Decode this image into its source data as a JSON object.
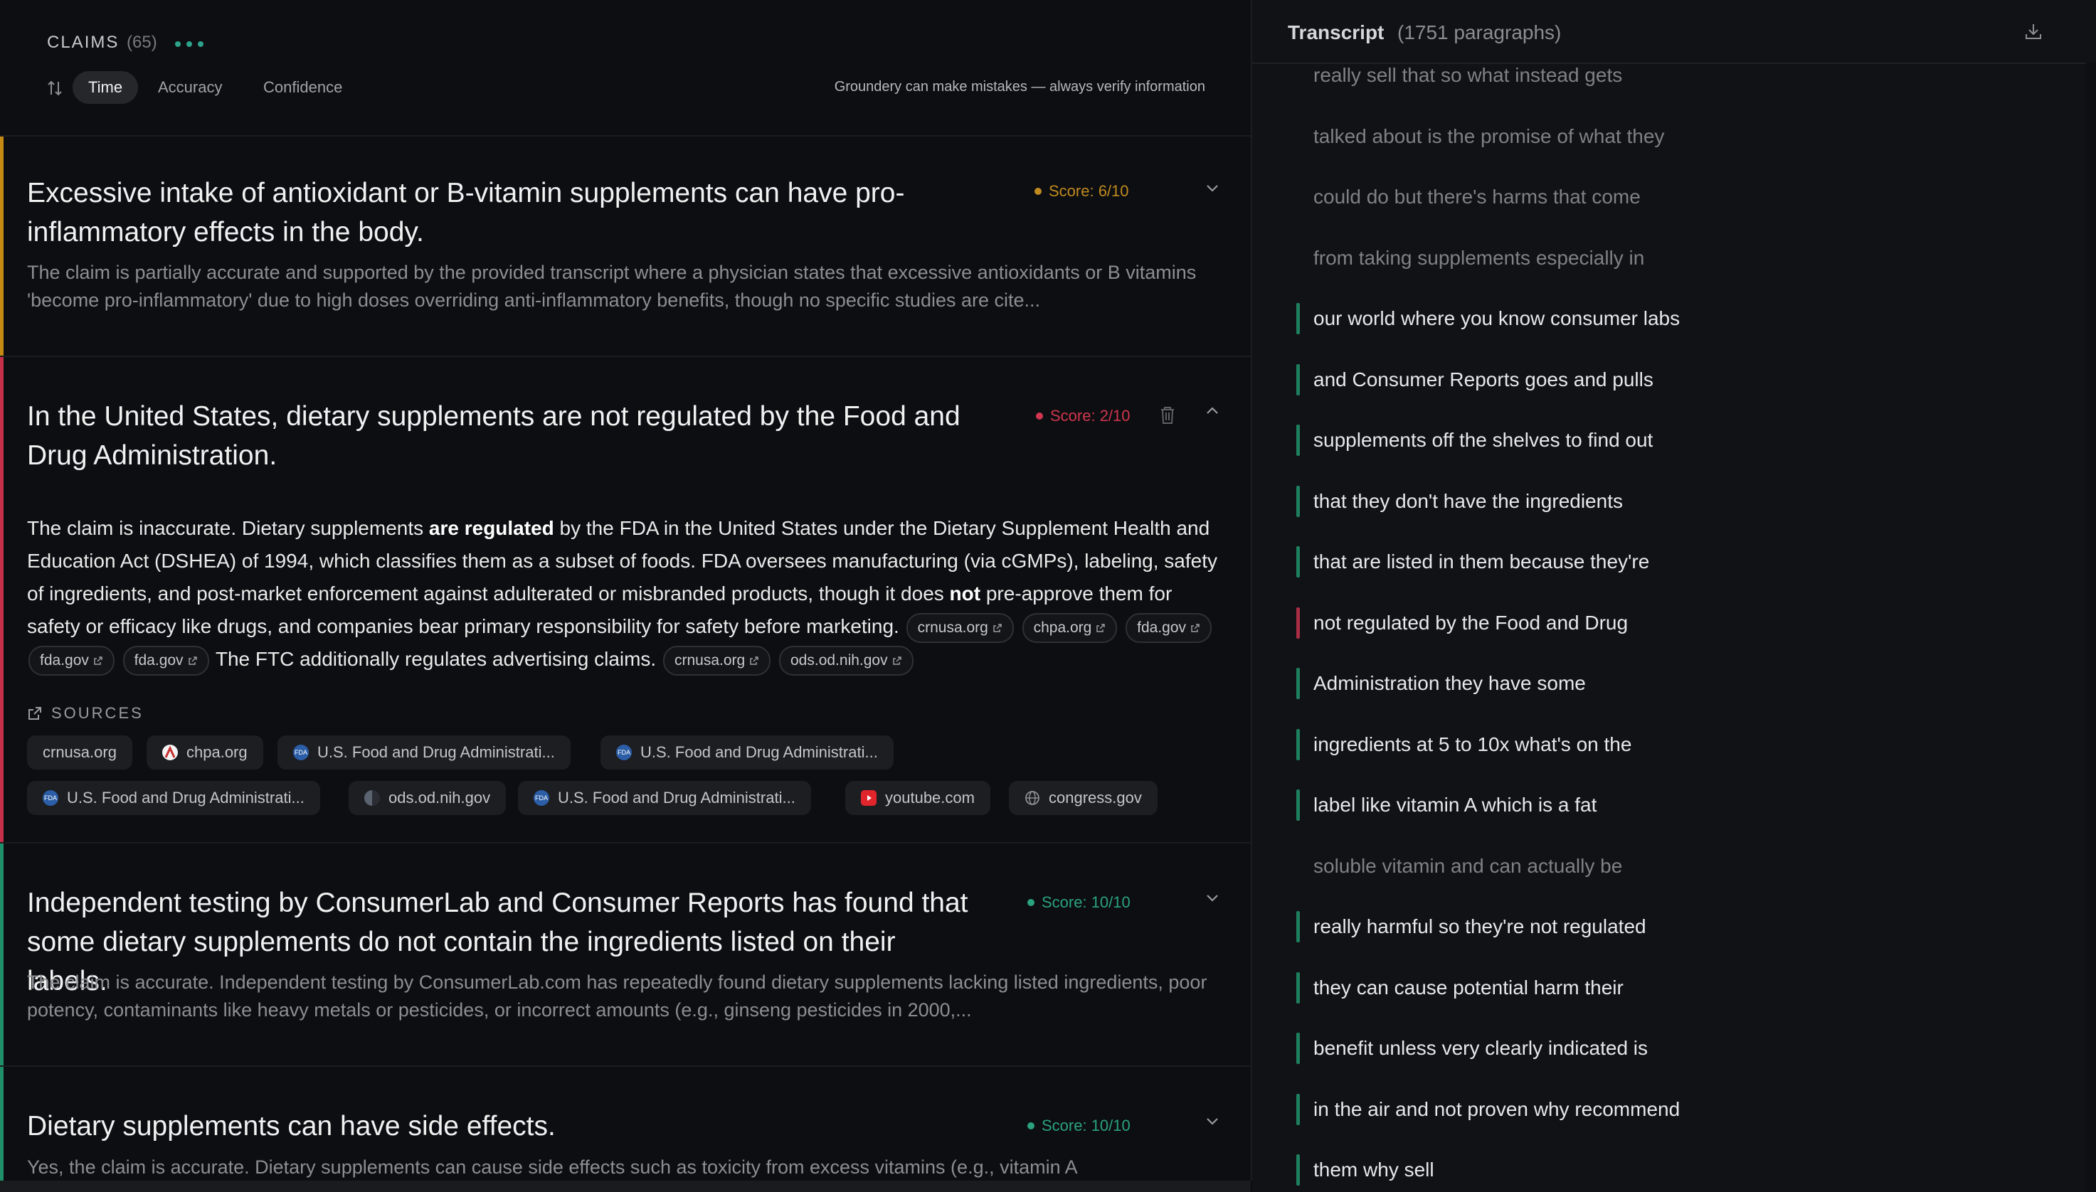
{
  "claims_panel": {
    "title": "CLAIMS",
    "count": "(65)",
    "sort_tabs": [
      "Time",
      "Accuracy",
      "Confidence"
    ],
    "disclaimer": "Groundery can make mistakes — always verify information"
  },
  "claims": [
    {
      "title": "Excessive intake of antioxidant or B-vitamin supplements can have pro-inflammatory effects in the body.",
      "score": "Score: 6/10",
      "summary": "The claim is partially accurate and supported by the provided transcript where a physician states that excessive antioxidants or B vitamins 'become pro-inflammatory' due to high doses overriding anti-inflammatory benefits, though no specific studies are cite..."
    },
    {
      "title": "In the United States, dietary supplements are not regulated by the Food and Drug Administration.",
      "score": "Score: 2/10",
      "detail": {
        "t1": "The claim is inaccurate. Dietary supplements ",
        "b1": "are regulated",
        "t2": " by the FDA in the United States under the Dietary Supplement Health and Education Act (DSHEA) of 1994, which classifies them as a subset of foods. FDA oversees manufacturing (via cGMPs), labeling, safety of ingredients, and post-market enforcement against adulterated or misbranded products, though it does ",
        "b2": "not",
        "t3": " pre-approve them for safety or efficacy like drugs, and companies bear primary responsibility for safety before marketing.",
        "chips_a": [
          "crnusa.org",
          "chpa.org",
          "fda.gov",
          "fda.gov",
          "fda.gov"
        ],
        "t4": " The FTC additionally regulates advertising claims.",
        "chips_b": [
          "crnusa.org",
          "ods.od.nih.gov"
        ]
      },
      "sources_label": "SOURCES",
      "sources": [
        {
          "label": "crnusa.org",
          "icon": "none"
        },
        {
          "label": "chpa.org",
          "icon": "chpa-logo"
        },
        {
          "label": "U.S. Food and Drug Administrati...",
          "icon": "fda-logo"
        },
        {
          "label": "U.S. Food and Drug Administrati...",
          "icon": "fda-logo"
        },
        {
          "label": "U.S. Food and Drug Administrati...",
          "icon": "fda-logo"
        },
        {
          "label": "ods.od.nih.gov",
          "icon": "nih-logo"
        },
        {
          "label": "U.S. Food and Drug Administrati...",
          "icon": "fda-logo"
        },
        {
          "label": "youtube.com",
          "icon": "youtube-logo"
        },
        {
          "label": "congress.gov",
          "icon": "globe-icon"
        }
      ]
    },
    {
      "title": "Independent testing by ConsumerLab and Consumer Reports has found that some dietary supplements do not contain the ingredients listed on their labels.",
      "score": "Score: 10/10",
      "summary": "The claim is accurate. Independent testing by ConsumerLab.com has repeatedly found dietary supplements lacking listed ingredients, poor potency, contaminants like heavy metals or pesticides, or incorrect amounts (e.g., ginseng pesticides in 2000,..."
    },
    {
      "title": "Dietary supplements can have side effects.",
      "score": "Score: 10/10",
      "summary": "Yes, the claim is accurate. Dietary supplements can cause side effects such as toxicity from excess vitamins (e.g., vitamin A"
    }
  ],
  "transcript": {
    "title": "Transcript",
    "count": "(1751 paragraphs)",
    "paragraphs": [
      {
        "text": "really sell that so what instead gets",
        "mark": "none"
      },
      {
        "text": "talked about is the promise of what they",
        "mark": "none"
      },
      {
        "text": "could do but there's harms that come",
        "mark": "none"
      },
      {
        "text": "from taking supplements especially in",
        "mark": "none"
      },
      {
        "text": "our world where you know consumer labs",
        "mark": "green"
      },
      {
        "text": "and Consumer Reports goes and pulls",
        "mark": "green"
      },
      {
        "text": "supplements off the shelves to find out",
        "mark": "green"
      },
      {
        "text": "that they don't have the ingredients",
        "mark": "green"
      },
      {
        "text": "that are listed in them because they're",
        "mark": "green"
      },
      {
        "text": "not regulated by the Food and Drug",
        "mark": "red"
      },
      {
        "text": "Administration they have some",
        "mark": "green"
      },
      {
        "text": "ingredients at 5 to 10x what's on the",
        "mark": "green"
      },
      {
        "text": "label like vitamin A which is a fat",
        "mark": "green"
      },
      {
        "text": "soluble vitamin and can actually be",
        "mark": "none"
      },
      {
        "text": "really harmful so they're not regulated",
        "mark": "green"
      },
      {
        "text": "they can cause potential harm their",
        "mark": "green"
      },
      {
        "text": "benefit unless very clearly indicated is",
        "mark": "green"
      },
      {
        "text": "in the air and not proven why recommend",
        "mark": "green"
      },
      {
        "text": "them why sell",
        "mark": "green"
      }
    ]
  },
  "colors": {
    "score_medium": "#c08a20",
    "score_low": "#d0364f",
    "score_high": "#2aa37c",
    "accent_dots": "#2ea38b"
  }
}
